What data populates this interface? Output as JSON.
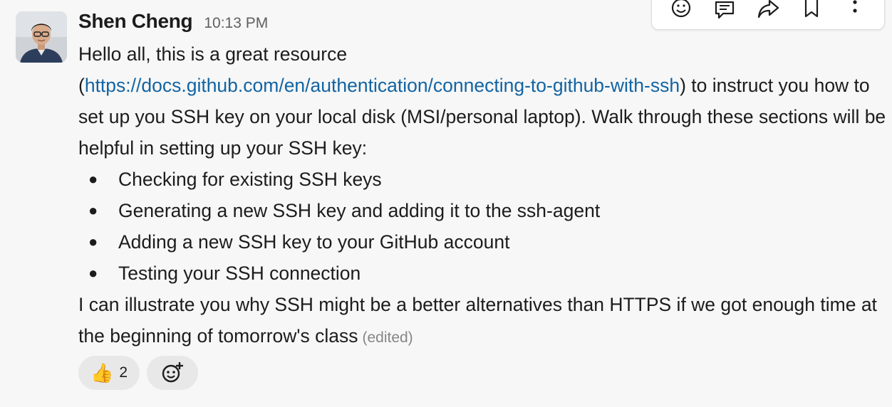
{
  "message": {
    "author": "Shen Cheng",
    "timestamp": "10:13 PM",
    "intro": "Hello all, this is a great resource",
    "link_prefix": "(",
    "link_text": "https://docs.github.com/en/authentication/connecting-to-github-with-ssh",
    "link_suffix": ") to instruct you how to set up you SSH key on your local disk (MSI/personal laptop). Walk through these sections will be helpful in setting up your SSH key:",
    "bullets": [
      "Checking for existing SSH keys",
      "Generating a new SSH key and adding it to the ssh-agent",
      "Adding a new SSH key to your GitHub account",
      "Testing your SSH connection"
    ],
    "closing": "I can illustrate you why SSH might be a better alternatives than HTTPS if we got enough time at the beginning of tomorrow's class",
    "edited_label": "(edited)"
  },
  "reactions": {
    "thumbs_up": {
      "emoji": "👍",
      "count": "2"
    },
    "add_reaction_icon": "add-reaction-icon"
  },
  "toolbar": {
    "icons": [
      "emoji-icon",
      "thread-reply-icon",
      "share-icon",
      "bookmark-icon",
      "more-actions-icon"
    ]
  },
  "colors": {
    "link": "#1264a3",
    "background": "#f7f7f7",
    "muted": "#616061"
  }
}
